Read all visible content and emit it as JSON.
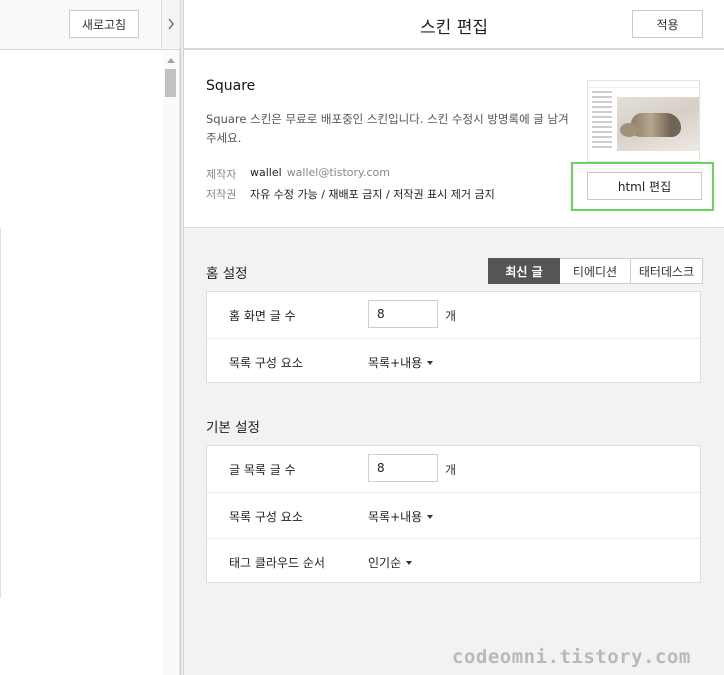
{
  "left": {
    "refresh_label": "새로고침",
    "toggle_icon": "chevron-right-icon"
  },
  "header": {
    "title": "스킨 편집",
    "apply_label": "적용"
  },
  "skin": {
    "name": "Square",
    "description": "Square 스킨은 무료로 배포중인 스킨입니다. 스킨 수정시 방명록에 글 남겨주세요.",
    "author_label": "제작자",
    "author_name": "wallel",
    "author_email": "wallel@tistory.com",
    "copyright_label": "저작권",
    "copyright_value": "자유 수정 가능 / 재배포 금지 / 저작권 표시 제거 금지",
    "html_edit_label": "html 편집",
    "highlight_color": "#6bd15f"
  },
  "home": {
    "title": "홈 설정",
    "tabs": [
      {
        "label": "최신 글",
        "active": true
      },
      {
        "label": "티에디션",
        "active": false
      },
      {
        "label": "태터데스크",
        "active": false
      }
    ],
    "post_count_label": "홈 화면 글 수",
    "post_count_value": "8",
    "post_count_unit": "개",
    "list_config_label": "목록 구성 요소",
    "list_config_value": "목록+내용"
  },
  "basic": {
    "title": "기본 설정",
    "post_count_label": "글 목록 글 수",
    "post_count_value": "8",
    "post_count_unit": "개",
    "list_config_label": "목록 구성 요소",
    "list_config_value": "목록+내용",
    "tag_order_label": "태그 클라우드 순서",
    "tag_order_value": "인기순"
  },
  "watermark": "codeomni.tistory.com"
}
